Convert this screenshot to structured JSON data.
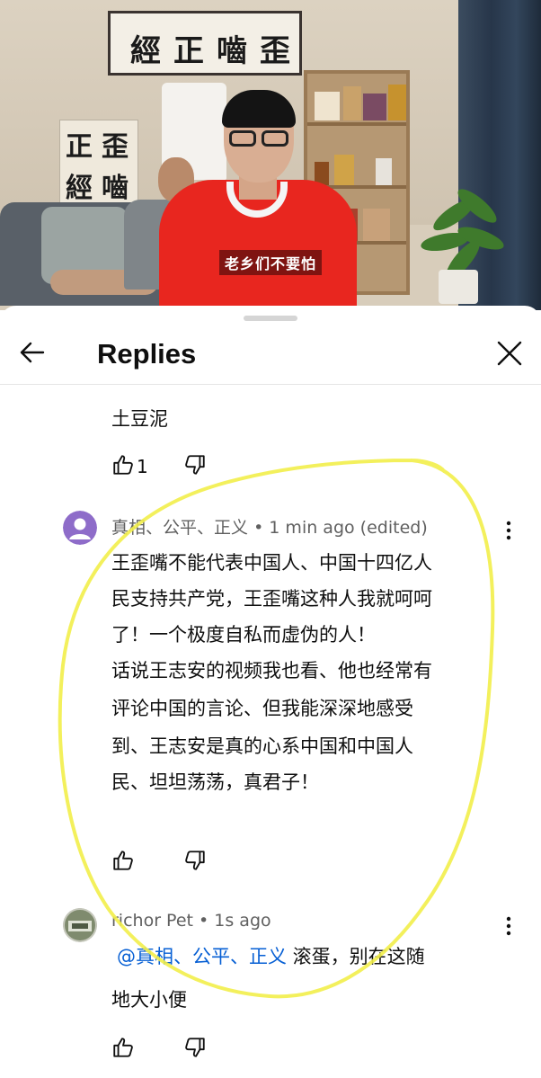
{
  "video": {
    "scroll_text": [
      "經",
      "正",
      "嚙",
      "歪"
    ],
    "poster_text": [
      "正",
      "歪",
      "經",
      "嚙"
    ],
    "subtitle": "老乡们不要怕"
  },
  "sheet": {
    "title": "Replies"
  },
  "previous_reply": {
    "text": "土豆泥",
    "like_count": "1"
  },
  "comments": [
    {
      "author": "真相、公平、正义",
      "meta": "• 1 min ago (edited)",
      "avatar_color": "#8e6cc9",
      "lines": [
        "王歪嘴不能代表中国人、中国十四亿人",
        "民支持共产党，王歪嘴这种人我就呵呵",
        "了！一个极度自私而虚伪的人！",
        "话说王志安的视频我也看、他也经常有",
        "评论中国的言论、但我能深深地感受",
        "到、王志安是真的心系中国和中国人",
        "民、坦坦荡荡，真君子！"
      ]
    },
    {
      "author": "richor Pet",
      "meta": "• 1s ago",
      "mention": "@真相、公平、正义",
      "line1_rest": " 滚蛋，别在这随",
      "line2": "地大小便"
    }
  ],
  "icons": {
    "back": "arrow-left-icon",
    "close": "close-icon",
    "like": "thumbs-up-icon",
    "dislike": "thumbs-down-icon",
    "more": "more-vertical-icon"
  },
  "colors": {
    "highlight": "#f2ee4a",
    "mention": "#065fd4",
    "meta": "#606060"
  }
}
